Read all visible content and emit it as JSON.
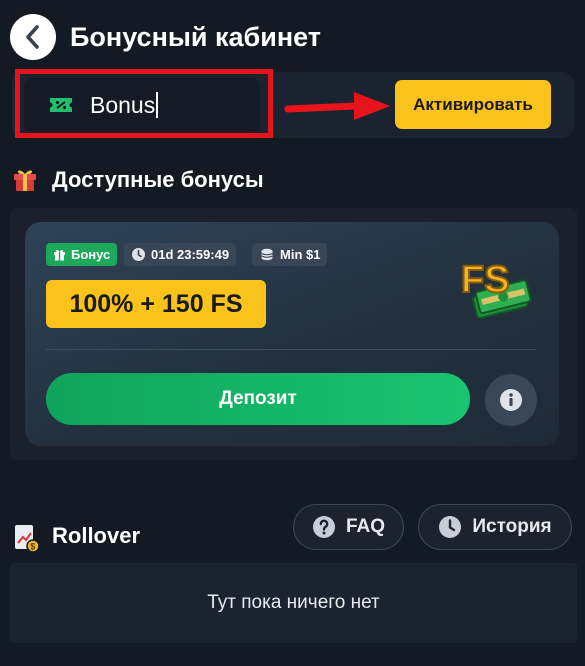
{
  "header": {
    "title": "Бонусный кабинет",
    "back_icon": "chevron-left-icon"
  },
  "promo": {
    "input_value": "Bonus",
    "input_icon": "ticket-icon",
    "activate_label": "Активировать",
    "accent_color": "#f9c31b",
    "highlight_color": "#e8141c"
  },
  "available": {
    "title": "Доступные бонусы",
    "icon": "gift-icon",
    "card": {
      "tag_bonus": "Бонус",
      "tag_timer": "01d 23:59:49",
      "tag_min": "Min $1",
      "offer": "100% + 150 FS",
      "fs_badge": "FS",
      "deposit_label": "Депозит",
      "deposit_color": "#19c471"
    }
  },
  "rollover": {
    "title": "Rollover",
    "faq_label": "FAQ",
    "history_label": "История",
    "empty_text": "Тут пока ничего нет"
  }
}
